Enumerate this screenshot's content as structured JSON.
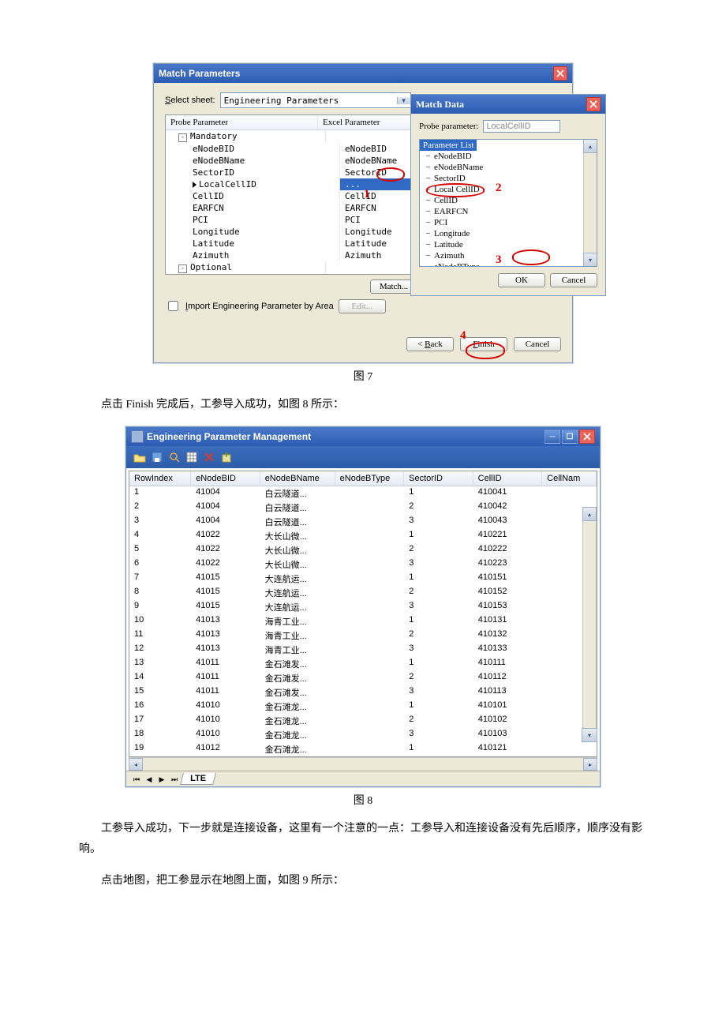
{
  "fig7": {
    "title": "Match Parameters",
    "select_sheet_label": "Select sheet:",
    "select_sheet_value": "Engineering Parameters",
    "headers": {
      "probe": "Probe Parameter",
      "excel": "Excel Parameter"
    },
    "groups": {
      "mandatory": "Mandatory",
      "optional": "Optional"
    },
    "rows": [
      {
        "p": "eNodeBID",
        "e": "eNodeBID"
      },
      {
        "p": "eNodeBName",
        "e": "eNodeBName"
      },
      {
        "p": "SectorID",
        "e": "SectorID"
      },
      {
        "p": "LocalCellID",
        "e": "...",
        "sel": true
      },
      {
        "p": "CellID",
        "e": "CellID"
      },
      {
        "p": "EARFCN",
        "e": "EARFCN"
      },
      {
        "p": "PCI",
        "e": "PCI"
      },
      {
        "p": "Longitude",
        "e": "Longitude"
      },
      {
        "p": "Latitude",
        "e": "Latitude"
      },
      {
        "p": "Azimuth",
        "e": "Azimuth"
      }
    ],
    "match_btn": "Match...",
    "import_cb": "Import Engineering Parameter by Area",
    "edit_btn": "Edit...",
    "back": "< Back",
    "finish": "Finish",
    "cancel": "Cancel",
    "match_data": {
      "title": "Match Data",
      "probe_param_label": "Probe parameter:",
      "probe_param_value": "LocalCellID",
      "list_header": "Parameter List",
      "items": [
        "eNodeBID",
        "eNodeBName",
        "SectorID",
        "Local CellID",
        "CellID",
        "EARFCN",
        "PCI",
        "Longitude",
        "Latitude",
        "Azimuth",
        "eNodeBType"
      ],
      "ok": "OK",
      "cancel": "Cancel"
    },
    "annots": {
      "n1": "1",
      "n2": "2",
      "n3": "3",
      "n4": "4"
    }
  },
  "captions": {
    "fig7": "图 7",
    "fig8": "图 8"
  },
  "text_after_fig7": "点击 Finish 完成后，工参导入成功，如图 8 所示：",
  "fig8": {
    "title": "Engineering Parameter Management",
    "sheet_tab": "LTE",
    "cols": [
      "RowIndex",
      "eNodeBID",
      "eNodeBName",
      "eNodeBType",
      "SectorID",
      "CellID",
      "CellNam"
    ],
    "rows": [
      [
        "1",
        "41004",
        "白云隧道...",
        "",
        "1",
        "410041",
        ""
      ],
      [
        "2",
        "41004",
        "白云隧道...",
        "",
        "2",
        "410042",
        ""
      ],
      [
        "3",
        "41004",
        "白云隧道...",
        "",
        "3",
        "410043",
        ""
      ],
      [
        "4",
        "41022",
        "大长山微...",
        "",
        "1",
        "410221",
        ""
      ],
      [
        "5",
        "41022",
        "大长山微...",
        "",
        "2",
        "410222",
        ""
      ],
      [
        "6",
        "41022",
        "大长山微...",
        "",
        "3",
        "410223",
        ""
      ],
      [
        "7",
        "41015",
        "大连航运...",
        "",
        "1",
        "410151",
        ""
      ],
      [
        "8",
        "41015",
        "大连航运...",
        "",
        "2",
        "410152",
        ""
      ],
      [
        "9",
        "41015",
        "大连航运...",
        "",
        "3",
        "410153",
        ""
      ],
      [
        "10",
        "41013",
        "海青工业...",
        "",
        "1",
        "410131",
        ""
      ],
      [
        "11",
        "41013",
        "海青工业...",
        "",
        "2",
        "410132",
        ""
      ],
      [
        "12",
        "41013",
        "海青工业...",
        "",
        "3",
        "410133",
        ""
      ],
      [
        "13",
        "41011",
        "金石滩发...",
        "",
        "1",
        "410111",
        ""
      ],
      [
        "14",
        "41011",
        "金石滩发...",
        "",
        "2",
        "410112",
        ""
      ],
      [
        "15",
        "41011",
        "金石滩发...",
        "",
        "3",
        "410113",
        ""
      ],
      [
        "16",
        "41010",
        "金石滩龙...",
        "",
        "1",
        "410101",
        ""
      ],
      [
        "17",
        "41010",
        "金石滩龙...",
        "",
        "2",
        "410102",
        ""
      ],
      [
        "18",
        "41010",
        "金石滩龙...",
        "",
        "3",
        "410103",
        ""
      ],
      [
        "19",
        "41012",
        "金石滩龙...",
        "",
        "1",
        "410121",
        ""
      ]
    ]
  },
  "text_after_fig8_p1": "工参导入成功，下一步就是连接设备，这里有一个注意的一点：工参导入和连接设备没有先后顺序，顺序没有影响。",
  "text_after_fig8_p2": "点击地图，把工参显示在地图上面，如图 9 所示："
}
